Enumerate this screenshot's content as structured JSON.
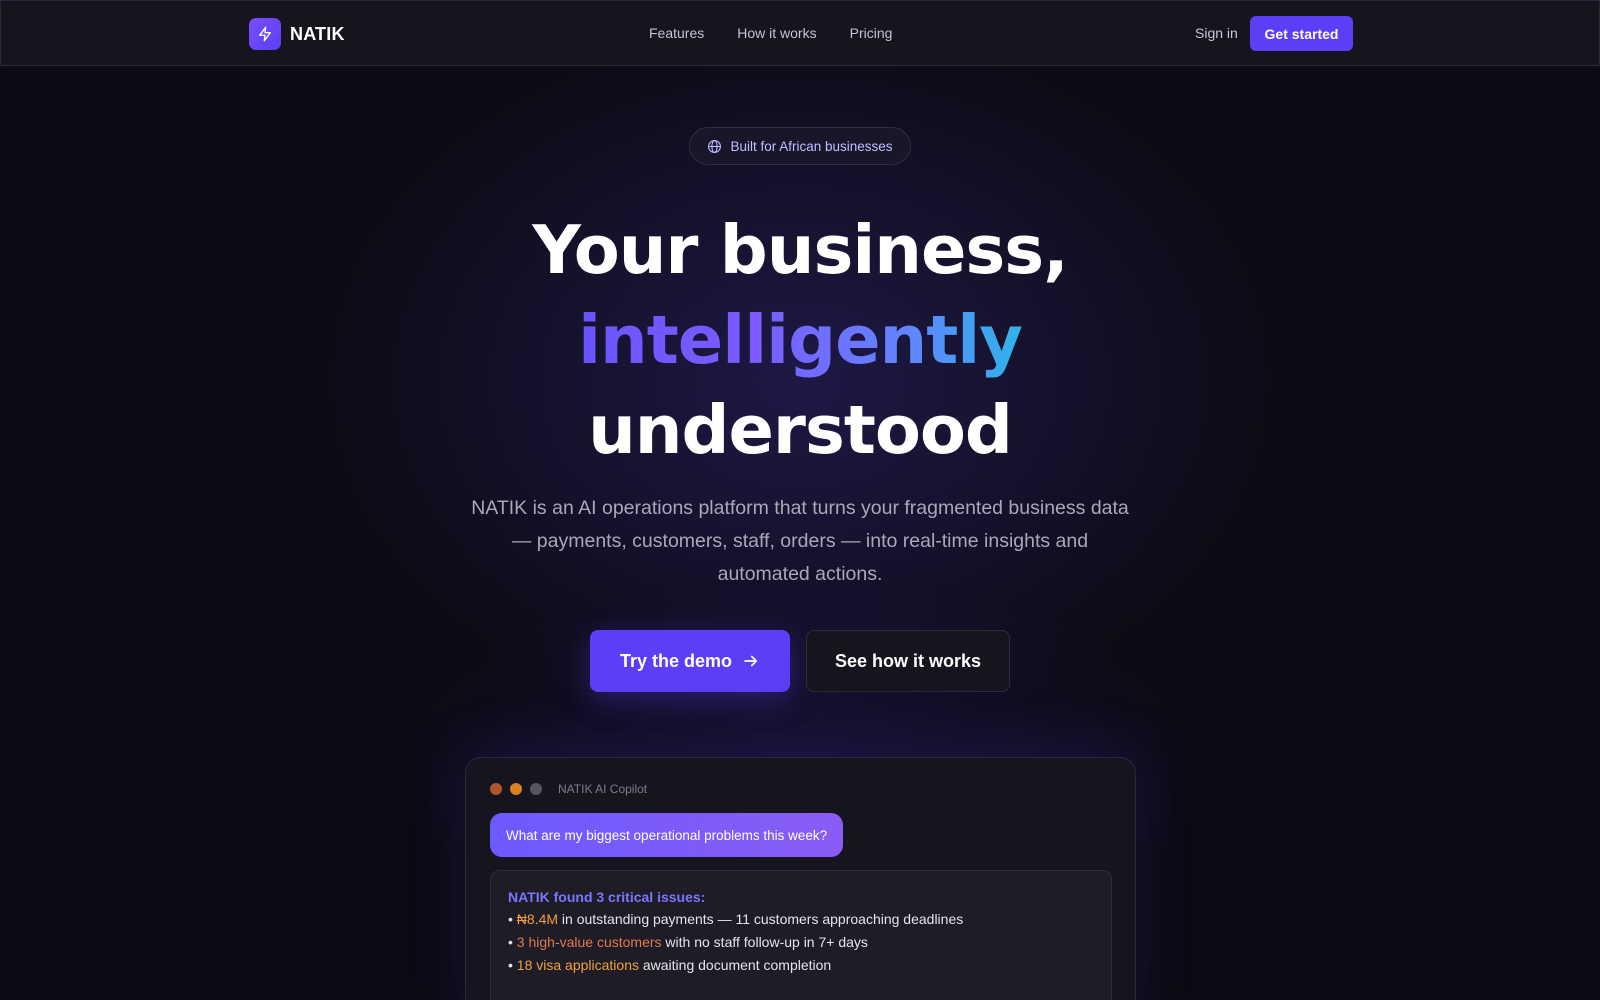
{
  "brand": {
    "name": "NATIK",
    "logo_icon": "bolt-icon",
    "accent": "#5b3ef5"
  },
  "nav": {
    "links": [
      "Features",
      "How it works",
      "Pricing"
    ],
    "sign_in": "Sign in",
    "cta": "Get started"
  },
  "hero": {
    "badge": "Built for African businesses",
    "badge_icon": "globe-icon",
    "headline_line1": "Your business,",
    "headline_line2": "intelligently",
    "headline_line3": "understood",
    "subtext": "NATIK is an AI operations platform that turns your fragmented business data — payments, customers, staff, orders — into real-time insights and automated actions.",
    "primary_cta": "Try the demo",
    "primary_cta_icon": "arrow-right-icon",
    "secondary_cta": "See how it works"
  },
  "copilot": {
    "title": "NATIK AI Copilot",
    "window_dot_colors": [
      "#b0562b",
      "#d9821f",
      "#55545f"
    ],
    "user_message": "What are my biggest operational problems this week?",
    "reply_title": "NATIK found 3 critical issues:",
    "issues": [
      {
        "highlight": "₦8.4M",
        "text": " in outstanding payments — 11 customers approaching deadlines"
      },
      {
        "highlight": "3 high-value customers",
        "text": " with no staff follow-up in 7+ days"
      },
      {
        "highlight": "18 visa applications",
        "text": " awaiting document completion"
      }
    ]
  }
}
